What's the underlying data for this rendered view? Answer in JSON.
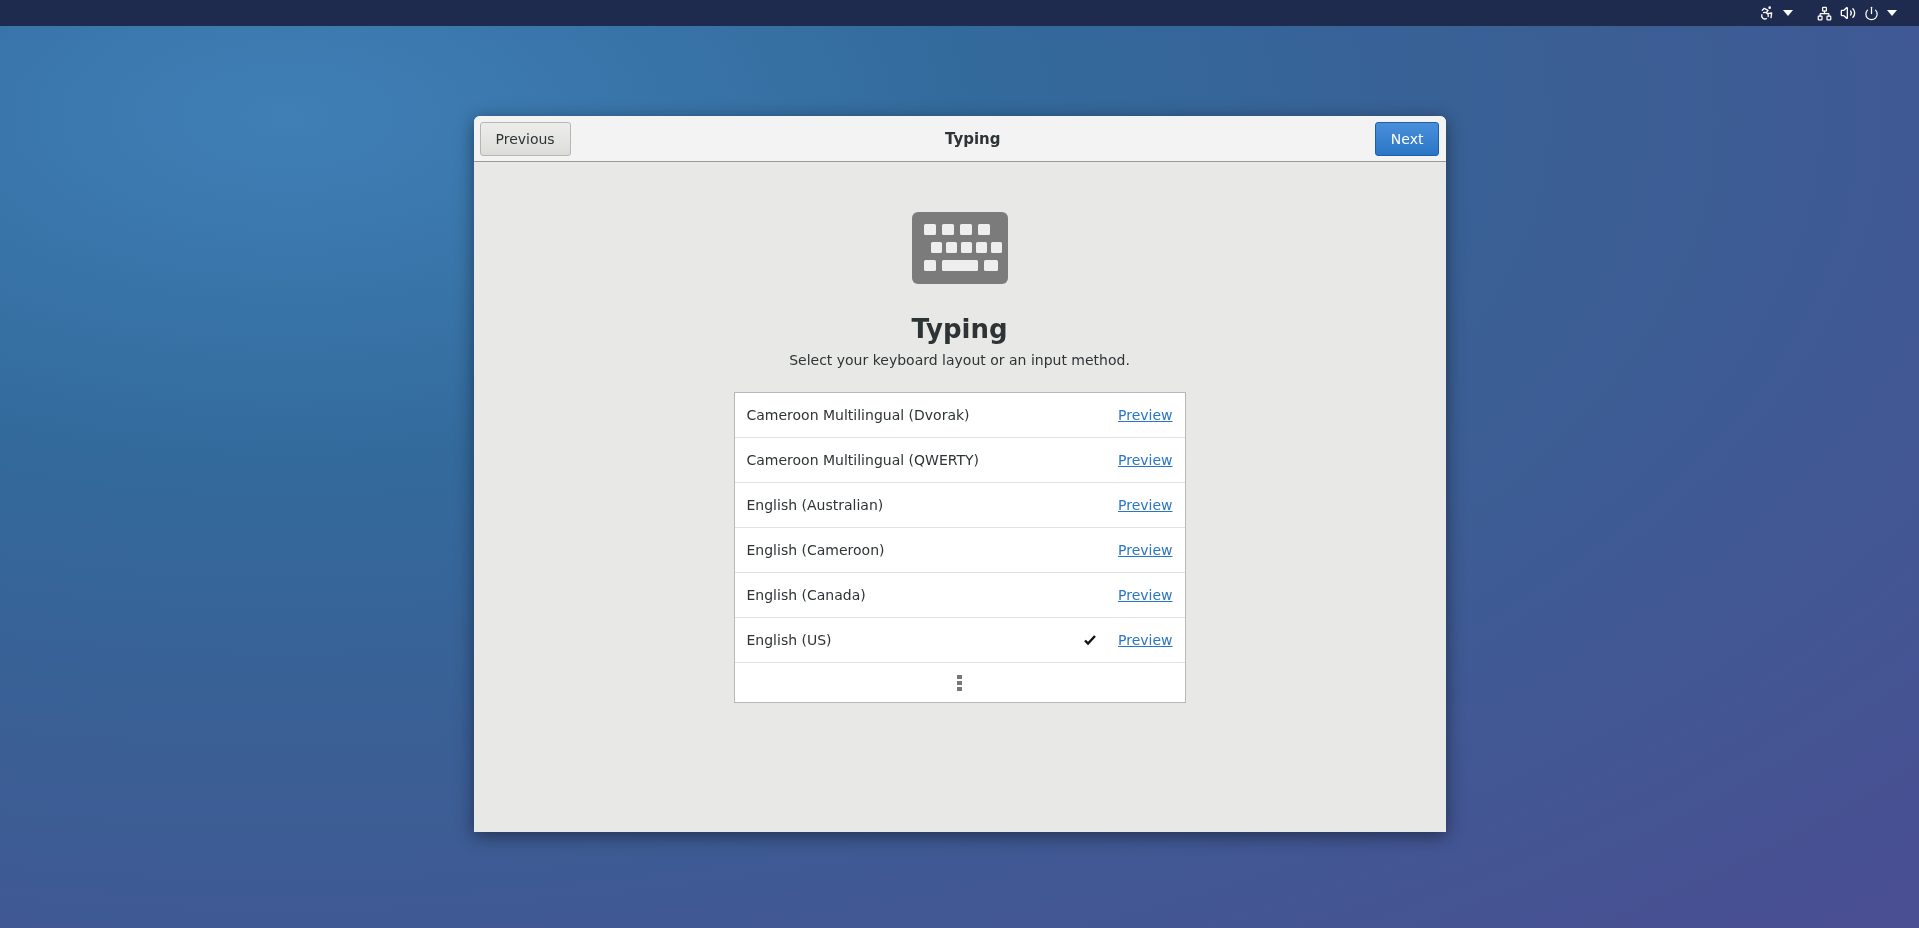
{
  "window": {
    "title": "Typing",
    "previous_button": "Previous",
    "next_button": "Next"
  },
  "page": {
    "heading": "Typing",
    "subtitle": "Select your keyboard layout or an input method."
  },
  "layouts": [
    {
      "name": "Cameroon Multilingual (Dvorak)",
      "preview": "Preview",
      "selected": false
    },
    {
      "name": "Cameroon Multilingual (QWERTY)",
      "preview": "Preview",
      "selected": false
    },
    {
      "name": "English (Australian)",
      "preview": "Preview",
      "selected": false
    },
    {
      "name": "English (Cameroon)",
      "preview": "Preview",
      "selected": false
    },
    {
      "name": "English (Canada)",
      "preview": "Preview",
      "selected": false
    },
    {
      "name": "English (US)",
      "preview": "Preview",
      "selected": true
    }
  ]
}
